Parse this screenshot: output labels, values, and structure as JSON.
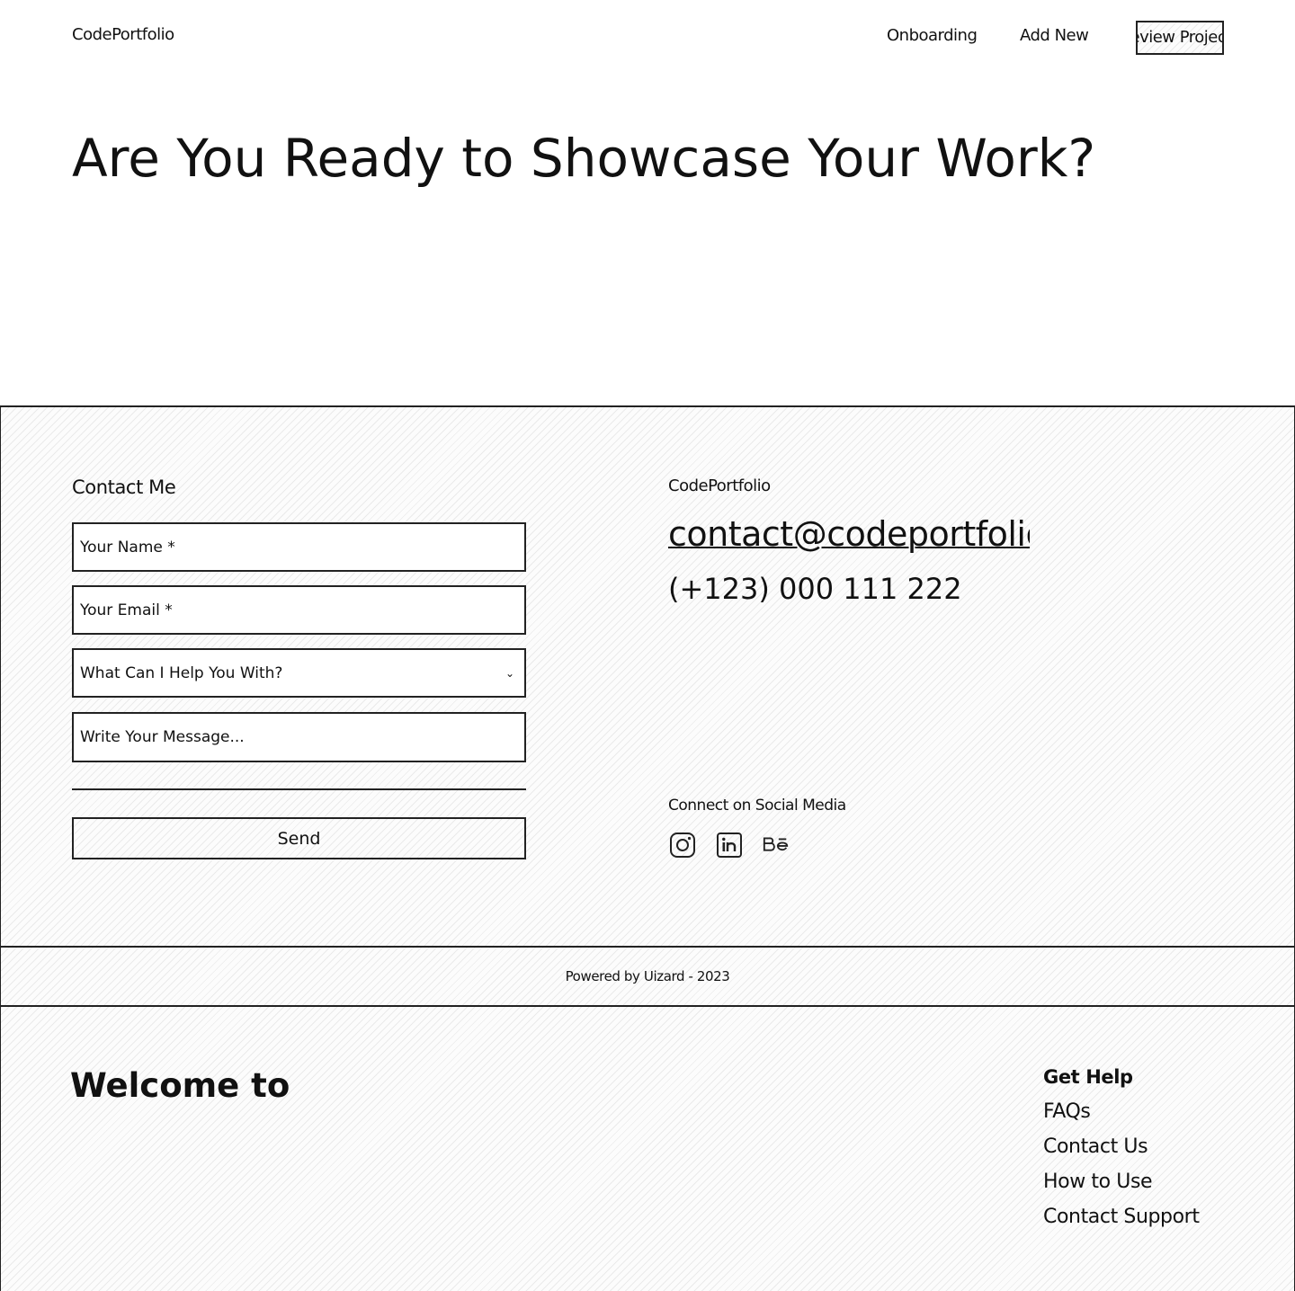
{
  "header": {
    "brand": "CodePortfolio",
    "nav": {
      "onboarding": "Onboarding",
      "add_new": "Add New",
      "review_projects": "Review Projects"
    }
  },
  "hero": {
    "title": "Are You Ready to Showcase Your Work?"
  },
  "contact": {
    "heading": "Contact Me",
    "name_placeholder": "Your Name *",
    "email_placeholder": "Your Email *",
    "help_select": "What Can I Help You With?",
    "message_placeholder": "Write Your Message...",
    "send_label": "Send",
    "brand": "CodePortfolio",
    "email": "contact@codeportfolio.com",
    "phone": "(+123) 000 111 222",
    "social_heading": "Connect on Social Media",
    "social_icons": [
      "instagram-icon",
      "linkedin-icon",
      "behance-icon"
    ]
  },
  "powered": {
    "text": "Powered by Uizard - 2023"
  },
  "footer": {
    "welcome": "Welcome to",
    "help_heading": "Get Help",
    "links": [
      "FAQs",
      "Contact Us",
      "How to Use",
      "Contact Support"
    ]
  }
}
